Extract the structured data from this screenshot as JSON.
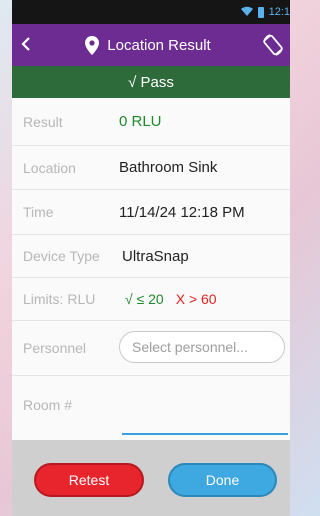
{
  "status_bar": {
    "time": "12:1"
  },
  "app_bar": {
    "title": "Location Result",
    "back_icon": "chevron-left-icon",
    "title_icon": "map-pin-icon",
    "action_icon": "rotate-screen-icon"
  },
  "result_banner": {
    "text": "√ Pass",
    "color": "#2e6b3a"
  },
  "fields": {
    "result": {
      "label": "Result",
      "value": "0 RLU"
    },
    "location": {
      "label": "Location",
      "value": "Bathroom Sink"
    },
    "time": {
      "label": "Time",
      "value": "11/14/24 12:18 PM"
    },
    "device_type": {
      "label": "Device Type",
      "value": "UltraSnap"
    },
    "limits": {
      "label": "Limits: RLU",
      "pass": "√ ≤ 20",
      "fail": "X > 60"
    },
    "personnel": {
      "label": "Personnel",
      "placeholder": "Select personnel..."
    },
    "room": {
      "label": "Room #",
      "value": ""
    }
  },
  "buttons": {
    "retest": "Retest",
    "done": "Done"
  },
  "colors": {
    "app_bar": "#6d2c91",
    "pass_green": "#1f8a2d",
    "fail_red": "#e02222",
    "retest_red": "#e8242c",
    "done_blue": "#3ea8e0"
  }
}
